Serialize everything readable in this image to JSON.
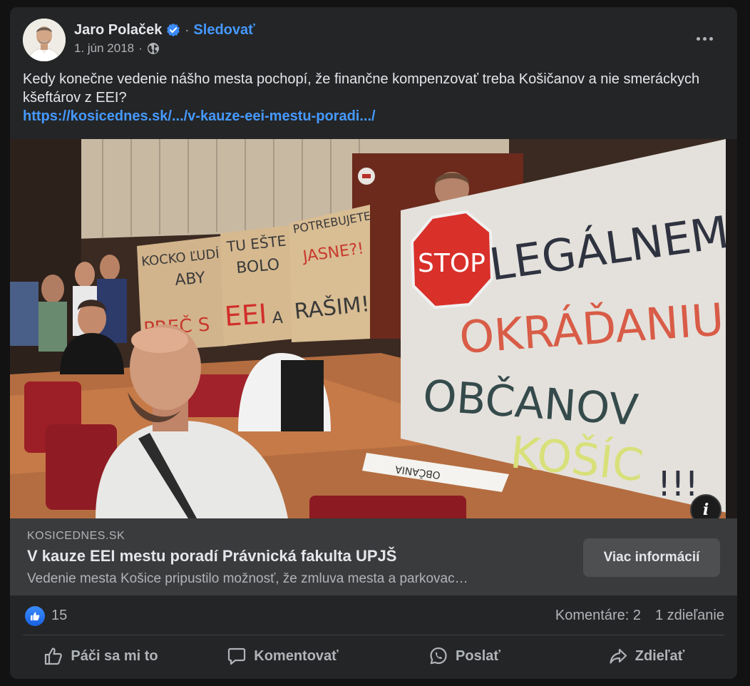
{
  "post": {
    "author": "Jaro Polaček",
    "follow_label": "Sledovať",
    "separator": "·",
    "date": "1. jún 2018",
    "date_separator": "·",
    "text": "Kedy konečne vedenie nášho mesta pochopí, že finančne kompenzovať treba Košičanov a nie smeráckych kšeftárov z EEI?",
    "link": "https://kosicednes.sk/.../v-kauze-eei-mestu-poradi.../"
  },
  "photo": {
    "signs": {
      "left_1": "KOCKO ĽUDÍ",
      "left_2": "ABY",
      "left_3": "PREČ S",
      "mid_1": "TU EŠTE",
      "mid_2": "BOLO",
      "mid_3": "EEI",
      "mid_4": "A",
      "right_1": "POTREBUJETE",
      "right_2": "JASNE?!",
      "right_3": "RAŠIM!",
      "stop": "STOP",
      "big_1": "LEGÁLNEMU",
      "big_2": "OKRÁĎANIU",
      "big_3": "OBČANOV",
      "big_4": "KOŠÍC",
      "big_5": "!!!",
      "desk_card": "OBČANIA"
    },
    "info_label": "i"
  },
  "preview": {
    "domain": "KOSICEDNES.SK",
    "title": "V kauze EEI mestu poradí Právnická fakulta UPJŠ",
    "description": "Vedenie mesta Košice pripustilo možnosť, že zmluva mesta a parkovac…",
    "button_label": "Viac informácií"
  },
  "stats": {
    "likes": "15",
    "comments": "Komentáre: 2",
    "shares": "1 zdieľanie"
  },
  "actions": {
    "like": "Páči sa mi to",
    "comment": "Komentovať",
    "send": "Poslať",
    "share": "Zdieľať"
  },
  "colors": {
    "card_bg": "#242526",
    "page_bg": "#121212",
    "accent": "#4599ff",
    "secondary_text": "#b0b3b8",
    "preview_bg": "#3a3b3c"
  }
}
